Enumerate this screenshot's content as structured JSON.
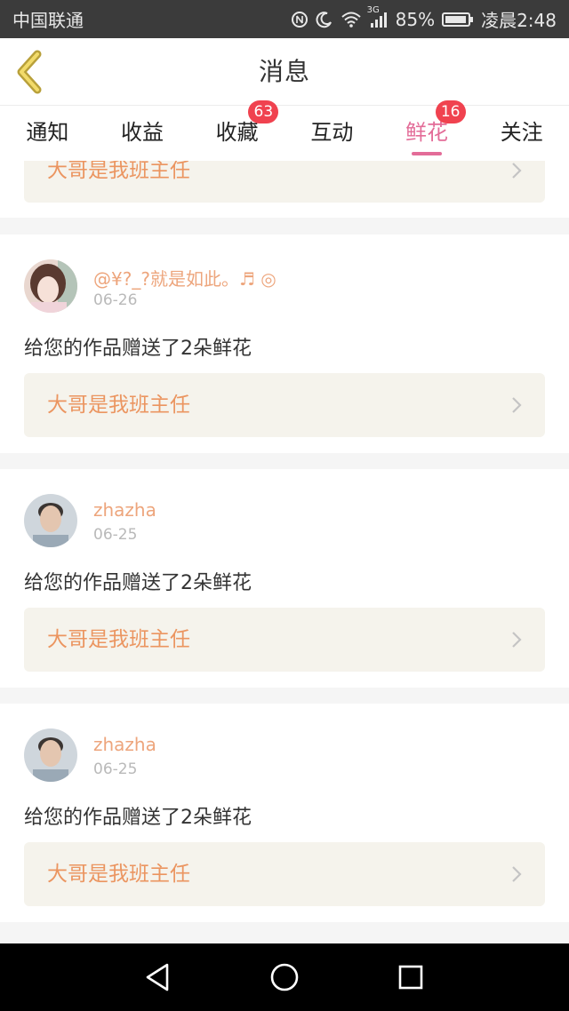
{
  "status_bar": {
    "carrier": "中国联通",
    "network": "3G",
    "battery": "85%",
    "time": "凌晨2:48",
    "icons": [
      "nfc-icon",
      "moon-icon",
      "wifi-icon",
      "signal-icon",
      "battery-icon"
    ]
  },
  "header": {
    "title": "消息",
    "back_icon": "chevron-left-icon"
  },
  "tabs": [
    {
      "label": "通知"
    },
    {
      "label": "收益"
    },
    {
      "label": "收藏",
      "badge": "63"
    },
    {
      "label": "互动"
    },
    {
      "label": "鲜花",
      "badge": "16",
      "active": true
    },
    {
      "label": "关注"
    }
  ],
  "partial_item": {
    "work_title": "大哥是我班主任"
  },
  "messages": [
    {
      "username": "@¥?_?就是如此。♬ ◎",
      "date": "06-26",
      "text": "给您的作品赠送了2朵鲜花",
      "work_title": "大哥是我班主任"
    },
    {
      "username": "zhazha",
      "date": "06-25",
      "text": "给您的作品赠送了2朵鲜花",
      "work_title": "大哥是我班主任"
    },
    {
      "username": "zhazha",
      "date": "06-25",
      "text": "给您的作品赠送了2朵鲜花",
      "work_title": "大哥是我班主任"
    }
  ],
  "nav_bar": {
    "icons": [
      "back-triangle-icon",
      "home-circle-icon",
      "recents-square-icon"
    ]
  },
  "colors": {
    "accent": "#e36c98",
    "badge": "#f0424f",
    "work_title": "#eb9560",
    "username": "#eda57c",
    "work_bg": "#f5f3ec"
  }
}
